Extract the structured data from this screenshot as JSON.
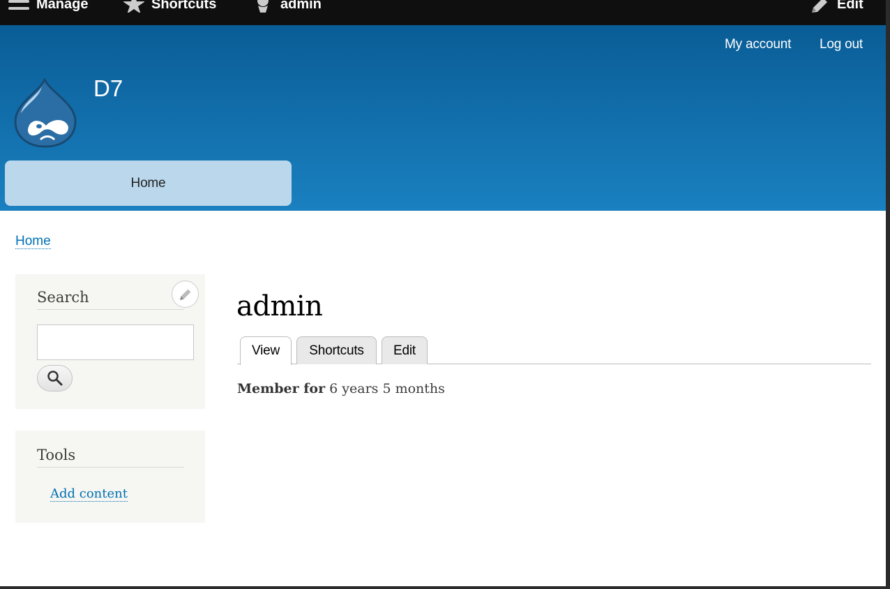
{
  "toolbar": {
    "manage_label": "Manage",
    "shortcuts_label": "Shortcuts",
    "user_label": "admin",
    "edit_label": "Edit"
  },
  "header": {
    "my_account": "My account",
    "log_out": "Log out",
    "site_name": "D7",
    "main_menu_home": "Home"
  },
  "breadcrumb": {
    "home": "Home"
  },
  "sidebar": {
    "search_title": "Search",
    "search_value": "",
    "tools_title": "Tools",
    "tools_link": "Add content"
  },
  "main": {
    "title": "admin",
    "tabs": [
      {
        "label": "View",
        "active": true
      },
      {
        "label": "Shortcuts",
        "active": false
      },
      {
        "label": "Edit",
        "active": false
      }
    ],
    "member_label": "Member for",
    "member_value": "6 years 5 months"
  },
  "colors": {
    "toolbar_bg": "#0f0f0f",
    "header_top": "#0a5d96",
    "header_bottom": "#1a80c0",
    "menu_tab_bg": "#bad7ec",
    "link": "#0071b3",
    "sidebar_bg": "#f6f6f2"
  },
  "icons": {
    "manage": "hamburger-icon",
    "shortcuts": "star-icon",
    "user": "user-icon",
    "edit": "pencil-icon",
    "contextual": "pencil-icon",
    "search": "magnifier-icon",
    "logo": "drupal-drop-logo"
  }
}
